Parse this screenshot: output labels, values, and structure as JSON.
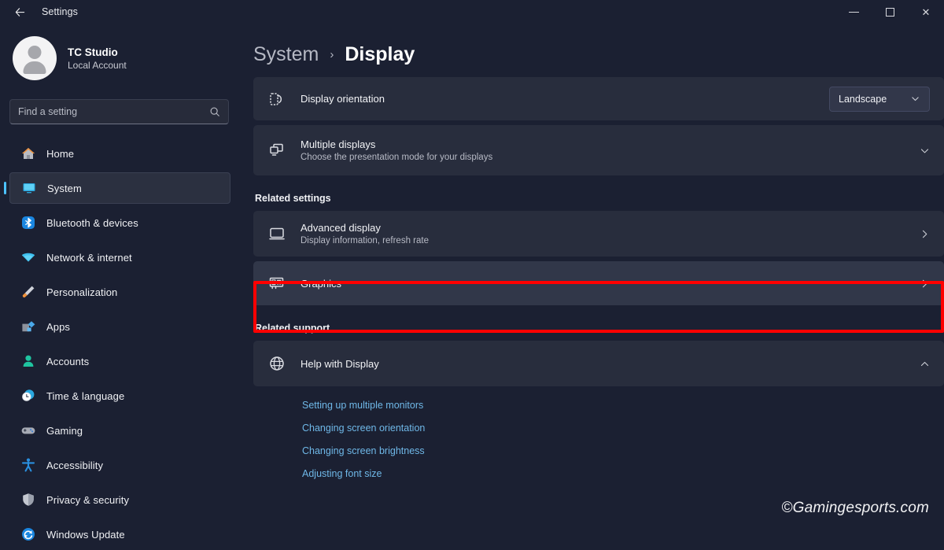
{
  "titlebar": {
    "back_label": "←",
    "title": "Settings",
    "minimize_label": "minimize",
    "maximize_label": "maximize",
    "close_label": "✕"
  },
  "sidebar": {
    "account": {
      "name": "TC Studio",
      "subtitle": "Local Account",
      "avatar_name": "user-avatar"
    },
    "search": {
      "placeholder": "Find a setting",
      "value": "",
      "icon": "search-icon"
    },
    "items": [
      {
        "label": "Home",
        "icon": "home-icon",
        "active": false
      },
      {
        "label": "System",
        "icon": "monitor-icon",
        "active": true
      },
      {
        "label": "Bluetooth & devices",
        "icon": "bluetooth-icon",
        "active": false
      },
      {
        "label": "Network & internet",
        "icon": "wifi-icon",
        "active": false
      },
      {
        "label": "Personalization",
        "icon": "brush-icon",
        "active": false
      },
      {
        "label": "Apps",
        "icon": "apps-icon",
        "active": false
      },
      {
        "label": "Accounts",
        "icon": "account-icon",
        "active": false
      },
      {
        "label": "Time & language",
        "icon": "clock-icon",
        "active": false
      },
      {
        "label": "Gaming",
        "icon": "gamepad-icon",
        "active": false
      },
      {
        "label": "Accessibility",
        "icon": "accessibility-icon",
        "active": false
      },
      {
        "label": "Privacy & security",
        "icon": "shield-icon",
        "active": false
      },
      {
        "label": "Windows Update",
        "icon": "update-icon",
        "active": false
      }
    ]
  },
  "main": {
    "breadcrumb": {
      "parent": "System",
      "separator": "›",
      "current": "Display"
    },
    "settings_rows": [
      {
        "title": "Display orientation",
        "subtitle": "",
        "icon": "display-orientation-icon",
        "control": "dropdown",
        "value": "Landscape"
      },
      {
        "title": "Multiple displays",
        "subtitle": "Choose the presentation mode for your displays",
        "icon": "multiple-displays-icon",
        "control": "expander",
        "value": ""
      }
    ],
    "related_settings": {
      "heading": "Related settings",
      "rows": [
        {
          "title": "Advanced display",
          "subtitle": "Display information, refresh rate",
          "icon": "advanced-display-icon",
          "control": "chevron-right",
          "highlighted": false
        },
        {
          "title": "Graphics",
          "subtitle": "",
          "icon": "graphics-card-icon",
          "control": "chevron-right",
          "highlighted": true
        }
      ]
    },
    "related_support": {
      "heading": "Related support",
      "row": {
        "title": "Help with Display",
        "icon": "globe-icon",
        "control": "chevron-up",
        "expanded": true
      },
      "links": [
        "Setting up multiple monitors",
        "Changing screen orientation",
        "Changing screen brightness",
        "Adjusting font size"
      ]
    }
  },
  "watermark": {
    "text": "©Gamingesports.com"
  },
  "colors": {
    "app_background": "#1b2032",
    "card_background": "#282d3d",
    "card_hover": "#313749",
    "accent": "#4cc2ff",
    "link": "#6fb8e8",
    "highlight_border": "#ff0000"
  }
}
